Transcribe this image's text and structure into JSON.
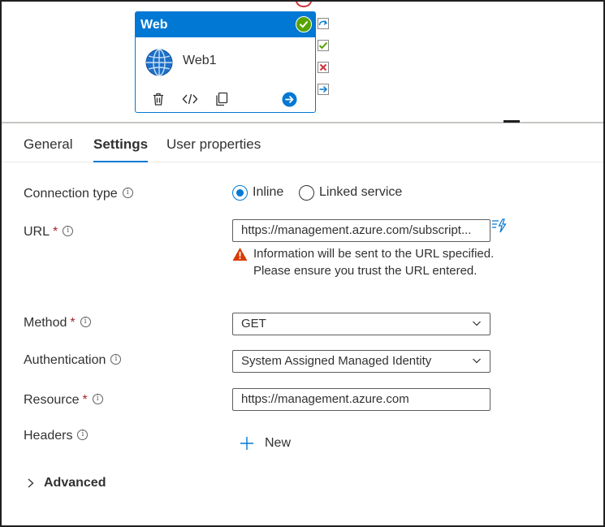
{
  "activity": {
    "type_label": "Web",
    "name": "Web1"
  },
  "tabs": [
    {
      "label": "General"
    },
    {
      "label": "Settings"
    },
    {
      "label": "User properties"
    }
  ],
  "form": {
    "connection_type": {
      "label": "Connection type",
      "options": [
        "Inline",
        "Linked service"
      ],
      "selected": "Inline"
    },
    "url": {
      "label": "URL",
      "required_mark": "*",
      "value": "https://management.azure.com/subscript...",
      "warning": "Information will be sent to the URL specified. Please ensure you trust the URL entered."
    },
    "method": {
      "label": "Method",
      "required_mark": "*",
      "value": "GET"
    },
    "authentication": {
      "label": "Authentication",
      "value": "System Assigned Managed Identity"
    },
    "resource": {
      "label": "Resource",
      "required_mark": "*",
      "value": "https://management.azure.com"
    },
    "headers": {
      "label": "Headers",
      "new_label": "New"
    },
    "advanced": {
      "label": "Advanced"
    }
  },
  "colors": {
    "accent": "#0078d4",
    "success": "#57a300",
    "error": "#d13438",
    "warning": "#d83b01"
  },
  "icons": {
    "activity_status": "check-circle-icon",
    "activity_type": "globe-icon",
    "delete": "trash-icon",
    "code": "code-icon",
    "copy": "copy-icon",
    "navigate": "arrow-right-circle-icon",
    "port_skip": "skip-arrow-icon",
    "port_success": "check-icon",
    "port_fail": "x-icon",
    "port_complete": "arrow-right-icon",
    "info": "info-icon",
    "warning": "warning-icon",
    "dynamic_content": "lightning-icon",
    "add": "plus-icon",
    "expand": "chevron-right-icon",
    "dropdown": "chevron-down-icon"
  }
}
